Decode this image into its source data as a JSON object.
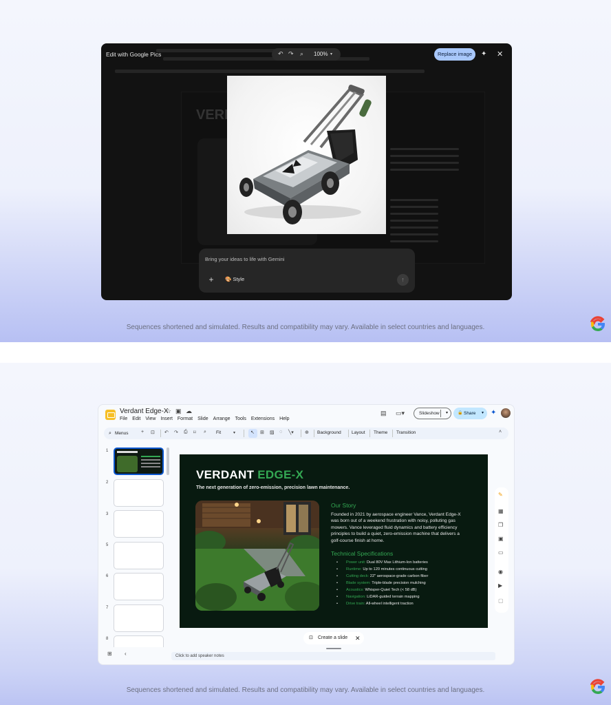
{
  "colors": {
    "accent_blue": "#a8c7fa",
    "brand_green": "#34a853",
    "slide_bg": "#081a10",
    "share_bg": "#c2e7ff"
  },
  "disclaimer": "Sequences shortened and simulated. Results and compatibility may vary. Available in select countries and languages.",
  "editor": {
    "title": "Edit with Google Pics",
    "zoom": "100%",
    "undo_icon": "undo-icon",
    "redo_icon": "redo-icon",
    "zoom_icon": "zoom-icon",
    "replace_label": "Replace image",
    "prompt_placeholder": "Bring your ideas to life with Gemini",
    "style_label": "Style",
    "image_subject": "lawn-mower-render"
  },
  "slides_app": {
    "doc_title": "Verdant Edge-X",
    "menus": [
      "File",
      "Edit",
      "View",
      "Insert",
      "Format",
      "Slide",
      "Arrange",
      "Tools",
      "Extensions",
      "Help"
    ],
    "slideshow_label": "Slideshow",
    "share_label": "Share",
    "toolbar": {
      "menus_label": "Menus",
      "zoom_label": "Fit",
      "background_label": "Background",
      "layout_label": "Layout",
      "theme_label": "Theme",
      "transition_label": "Transition"
    },
    "thumbnails": [
      "1",
      "2",
      "3",
      "5",
      "6",
      "7",
      "8"
    ],
    "slide": {
      "title_white": "VERDANT ",
      "title_green": "EDGE-X",
      "subtitle": "The next generation of zero-emission, precision lawn maintenance.",
      "story_heading": "Our Story",
      "story_body": "Founded in 2021 by aerospace engineer Vance, Verdant Edge-X was born out of a weekend frustration with noisy, polluting gas mowers. Vance leveraged fluid dynamics and battery efficiency principles to build a quiet, zero-emission machine that delivers a golf-course finish at home.",
      "specs_heading": "Technical Specifications",
      "specs": [
        {
          "key": "Power unit:",
          "value": "Dual 80V Max Lithium-Ion batteries"
        },
        {
          "key": "Runtime:",
          "value": "Up to 120 minutes continuous cutting"
        },
        {
          "key": "Cutting deck:",
          "value": "22\" aerospace-grade carbon fiber"
        },
        {
          "key": "Blade system:",
          "value": "Triple-blade precision mulching"
        },
        {
          "key": "Acoustics:",
          "value": "Whisper-Quiet Tech (< 58 dB)"
        },
        {
          "key": "Navigation:",
          "value": "LiDAR-guided terrain mapping"
        },
        {
          "key": "Drive train:",
          "value": "All-wheel intelligent traction"
        }
      ]
    },
    "create_slide_label": "Create a slide",
    "speaker_notes_placeholder": "Click to add speaker notes"
  }
}
